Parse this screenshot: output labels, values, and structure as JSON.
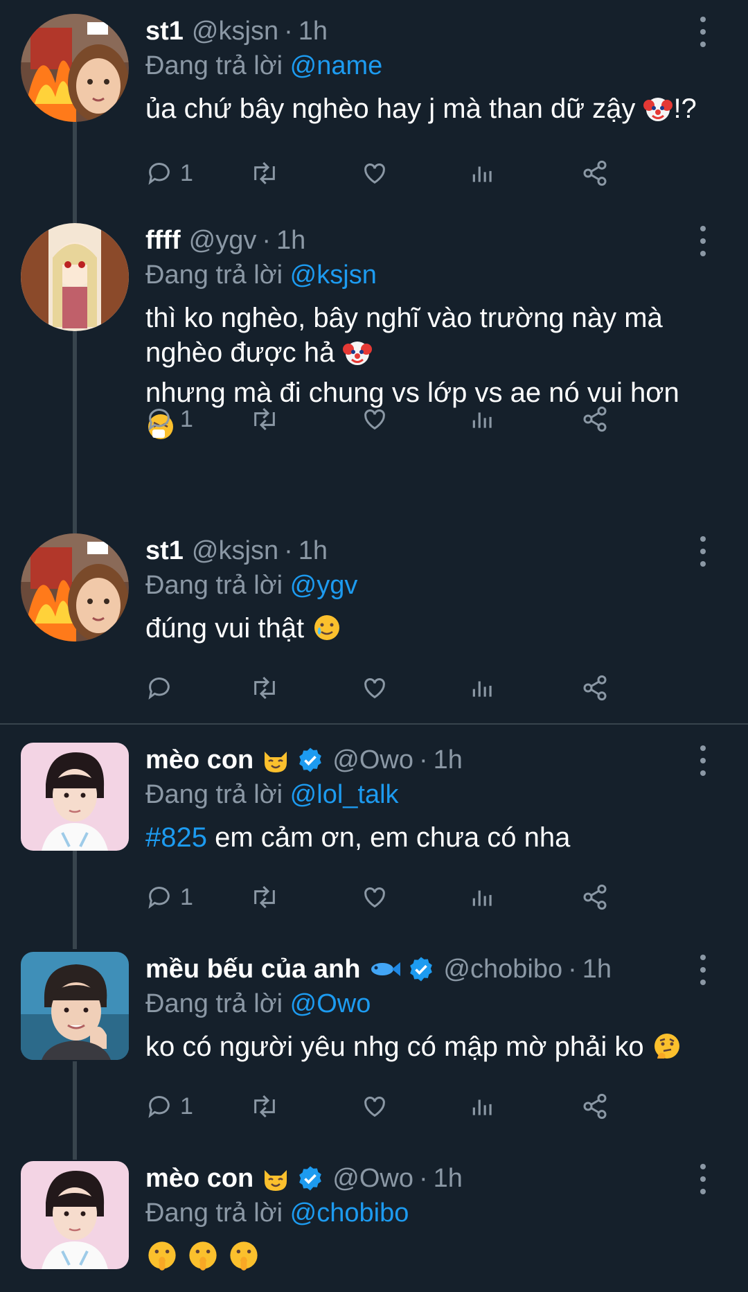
{
  "reply_prefix": "Đang trả lời",
  "tweets": [
    {
      "name": "st1",
      "handle": "@ksjsn",
      "dot": "·",
      "time": "1h",
      "reply_to": "@name",
      "text_before": "ủa chứ bây nghèo hay j mà than dữ zậy ",
      "text_after": "!?",
      "reply_count": "1"
    },
    {
      "name": "ffff",
      "handle": "@ygv",
      "dot": "·",
      "time": "1h",
      "reply_to": "@ksjsn",
      "line1": "thì ko nghèo, bây nghĩ vào trường này mà",
      "line2": "nghèo được hả ",
      "line3": "nhưng mà đi chung vs lớp vs ae nó vui hơn",
      "reply_count": "1"
    },
    {
      "name": "st1",
      "handle": "@ksjsn",
      "dot": "·",
      "time": "1h",
      "reply_to": "@ygv",
      "text_before": "đúng vui thật ",
      "reply_count": ""
    },
    {
      "name": "mèo con",
      "handle": "@Owo",
      "dot": "·",
      "time": "1h",
      "reply_to": "@lol_talk",
      "hashtag": "#825",
      "text_after": " em cảm ơn, em chưa có nha",
      "reply_count": "1",
      "verified": true
    },
    {
      "name": "mều bếu của anh",
      "handle": "@chobibo",
      "dot": "·",
      "time": "1h",
      "reply_to": "@Owo",
      "text_before": "ko có người yêu nhg có mập mờ phải ko ",
      "reply_count": "1",
      "verified": true
    },
    {
      "name": "mèo con",
      "handle": "@Owo",
      "dot": "·",
      "time": "1h",
      "reply_to": "@chobibo",
      "reply_count": "",
      "verified": true
    }
  ],
  "icons": {
    "reply": "reply-icon",
    "retweet": "retweet-icon",
    "like": "heart-icon",
    "views": "views-icon",
    "share": "share-icon",
    "more": "more-options-icon",
    "verified": "verified-badge-icon"
  },
  "colors": {
    "background": "#15202b",
    "text": "#ffffff",
    "muted": "#8b98a5",
    "accent": "#1d9bf0",
    "line": "#38444d"
  }
}
